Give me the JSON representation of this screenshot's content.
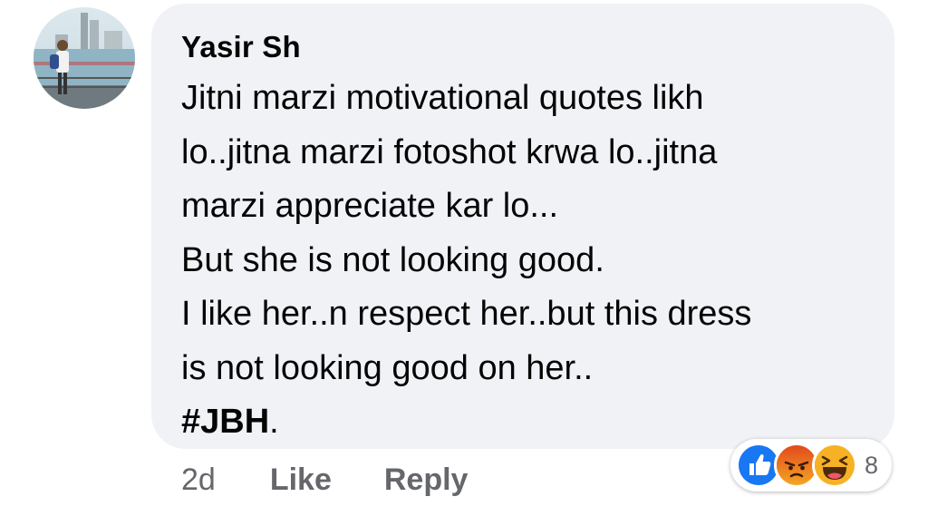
{
  "comment": {
    "author": "Yasir Sh",
    "lines": [
      "Jitni marzi motivational quotes likh",
      "lo..jitna marzi fotoshot krwa lo..jitna",
      "marzi appreciate kar lo...",
      "But she is not looking good.",
      "I like her..n respect her..but this dress",
      "is not looking good on her.."
    ],
    "hashtag": "#JBH",
    "hashtag_suffix": "."
  },
  "actions": {
    "timestamp": "2d",
    "like_label": "Like",
    "reply_label": "Reply"
  },
  "reactions": {
    "icons": [
      "like-icon",
      "angry-icon",
      "haha-icon"
    ],
    "count": "8"
  },
  "colors": {
    "bubble_bg": "#f0f2f5",
    "text": "#050505",
    "secondary_text": "#65676b",
    "like_blue": "#1877f2",
    "angry_orange": "#e9710f",
    "haha_yellow": "#f7b125"
  }
}
